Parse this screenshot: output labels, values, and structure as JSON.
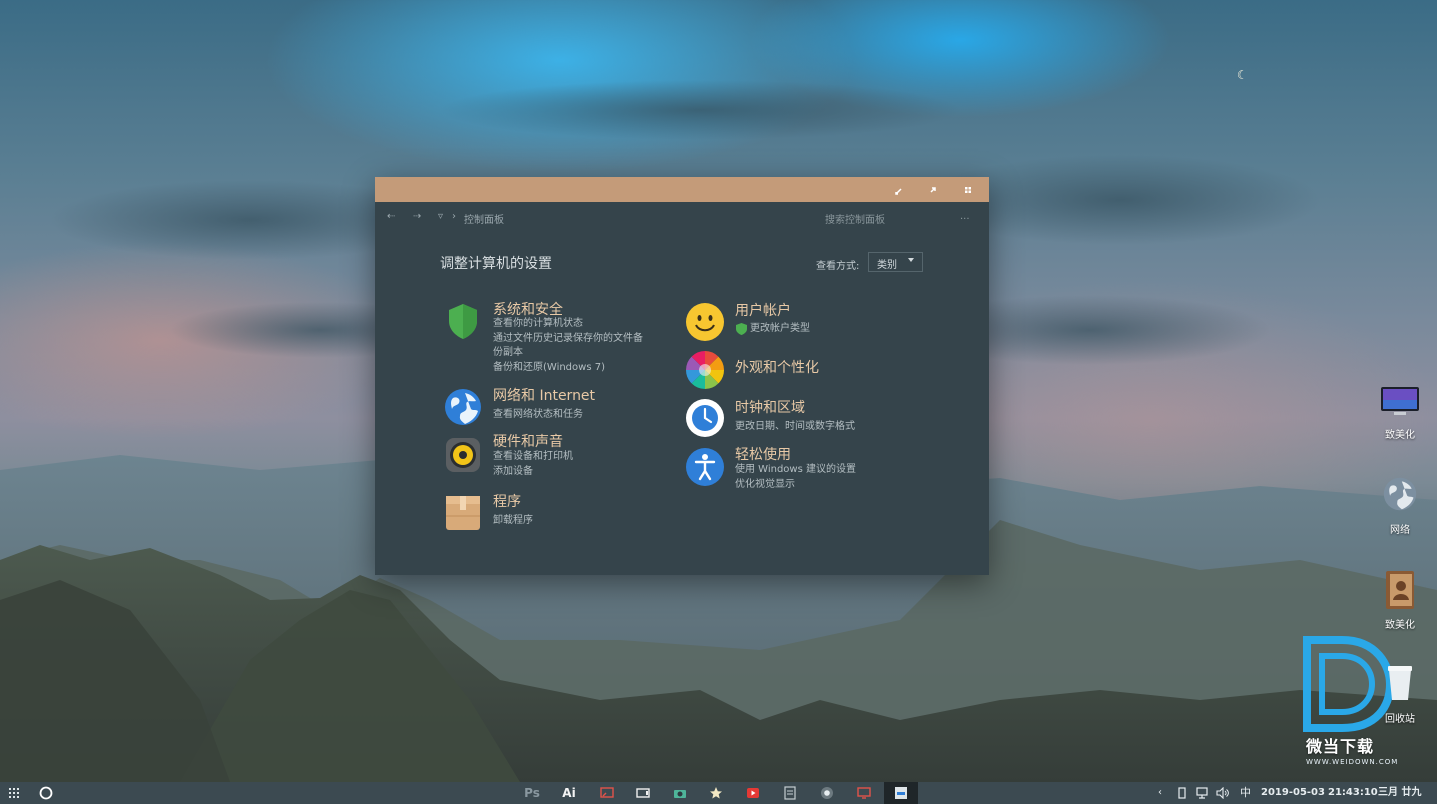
{
  "window": {
    "titlebar_buttons": [
      "minimize-icon",
      "maximize-icon",
      "close-icon"
    ],
    "address": {
      "back": "⇠",
      "forward": "⇢",
      "dropdown": "▿",
      "separator": "›",
      "path": "控制面板"
    },
    "search_placeholder": "搜索控制面板",
    "search_more": "...",
    "heading": "调整计算机的设置",
    "view_by_label": "查看方式:",
    "view_by_value": "类别",
    "categories": [
      {
        "title": "系统和安全",
        "links": [
          "查看你的计算机状态",
          "通过文件历史记录保存你的文件备",
          "份副本",
          "备份和还原(Windows 7)"
        ],
        "icon": "shield-icon"
      },
      {
        "title": "网络和 Internet",
        "links": [
          "查看网络状态和任务"
        ],
        "icon": "globe-icon"
      },
      {
        "title": "硬件和声音",
        "links": [
          "查看设备和打印机",
          "添加设备"
        ],
        "icon": "speaker-icon"
      },
      {
        "title": "程序",
        "links": [
          "卸载程序"
        ],
        "icon": "package-icon"
      },
      {
        "title": "用户帐户",
        "links": [
          "更改帐户类型"
        ],
        "icon": "smiley-icon"
      },
      {
        "title": "外观和个性化",
        "links": [],
        "icon": "color-wheel-icon"
      },
      {
        "title": "时钟和区域",
        "links": [
          "更改日期、时间或数字格式"
        ],
        "icon": "clock-icon"
      },
      {
        "title": "轻松使用",
        "links": [
          "使用 Windows 建议的设置",
          "优化视觉显示"
        ],
        "icon": "accessibility-icon"
      }
    ]
  },
  "desktop_icons": [
    {
      "label": "致美化",
      "icon": "monitor-icon"
    },
    {
      "label": "网络",
      "icon": "network-globe-icon"
    },
    {
      "label": "致美化",
      "icon": "contacts-book-icon"
    },
    {
      "label": "回收站",
      "icon": "recycle-bin-icon"
    }
  ],
  "watermark": {
    "text": "微当下载",
    "sub": "WWW.WEIDOWN.COM"
  },
  "taskbar": {
    "apps": [
      "Ps",
      "Ai"
    ],
    "tray": {
      "ime": "中",
      "date": "2019-05-03",
      "time": "21:43:10",
      "lunar": "三月 廿九"
    }
  },
  "colors": {
    "titlebar": "#c49b79",
    "window_bg": "#35444b",
    "category_title": "#e8c9a6",
    "taskbar": "#3c4a51"
  }
}
